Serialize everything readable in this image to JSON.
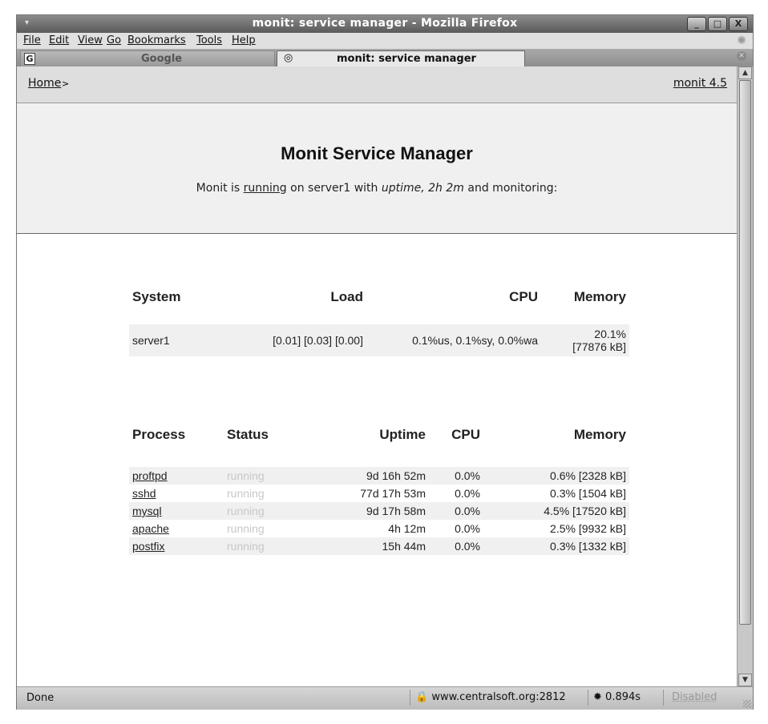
{
  "window": {
    "title": "monit: service manager - Mozilla Firefox",
    "buttons": [
      "_",
      "□",
      "X"
    ]
  },
  "menu": {
    "file": "File",
    "edit": "Edit",
    "view": "View",
    "go": "Go",
    "bookmarks": "Bookmarks",
    "tools": "Tools",
    "help": "Help"
  },
  "tabs": {
    "google_icon": "G",
    "google": "Google",
    "active": "monit: service manager"
  },
  "nav": {
    "home": "Home",
    "home_arrow": ">",
    "version": "monit 4.5"
  },
  "header": {
    "title": "Monit Service Manager",
    "pre": "Monit is ",
    "running": "running",
    "mid": " on server1 with ",
    "uptime": "uptime, 2h 2m",
    "post": "  and monitoring:"
  },
  "system": {
    "headers": {
      "system": "System",
      "load": "Load",
      "cpu": "CPU",
      "memory": "Memory"
    },
    "row": {
      "name": "server1",
      "load": "[0.01] [0.03] [0.00]",
      "cpu": "0.1%us, 0.1%sy, 0.0%wa",
      "mem_pct": "20.1%",
      "mem_kb": "[77876 kB]"
    }
  },
  "process": {
    "headers": {
      "process": "Process",
      "status": "Status",
      "uptime": "Uptime",
      "cpu": "CPU",
      "memory": "Memory"
    },
    "rows": [
      {
        "name": "proftpd",
        "status": "running",
        "uptime": "9d 16h 52m",
        "cpu": "0.0%",
        "memory": "0.6% [2328 kB]"
      },
      {
        "name": "sshd",
        "status": "running",
        "uptime": "77d 17h 53m",
        "cpu": "0.0%",
        "memory": "0.3% [1504 kB]"
      },
      {
        "name": "mysql",
        "status": "running",
        "uptime": "9d 17h 58m",
        "cpu": "0.0%",
        "memory": "4.5% [17520 kB]"
      },
      {
        "name": "apache",
        "status": "running",
        "uptime": "4h 12m",
        "cpu": "0.0%",
        "memory": "2.5% [9932 kB]"
      },
      {
        "name": "postfix",
        "status": "running",
        "uptime": "15h 44m",
        "cpu": "0.0%",
        "memory": "0.3% [1332 kB]"
      }
    ]
  },
  "statusbar": {
    "done": "Done",
    "url": "www.centralsoft.org:2812",
    "time": "0.894s",
    "disabled": "Disabled"
  }
}
